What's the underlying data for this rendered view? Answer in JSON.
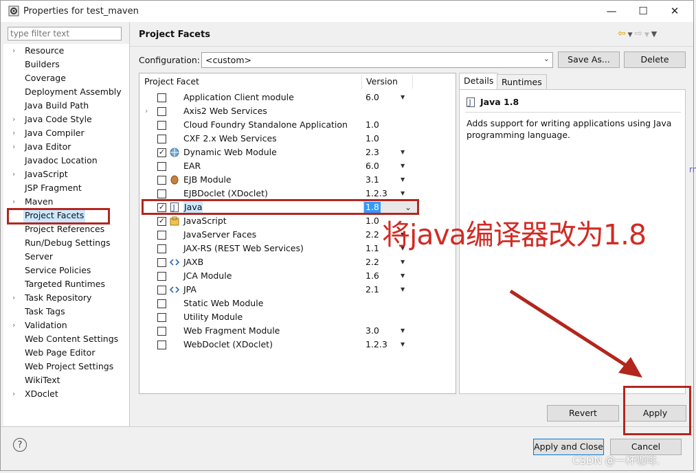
{
  "window": {
    "title": "Properties for test_maven",
    "minimize": "—",
    "maximize": "☐",
    "close": "✕"
  },
  "filter": {
    "placeholder": "type filter text"
  },
  "tree": {
    "items": [
      {
        "label": "Resource",
        "expandable": true
      },
      {
        "label": "Builders",
        "expandable": false
      },
      {
        "label": "Coverage",
        "expandable": false
      },
      {
        "label": "Deployment Assembly",
        "expandable": false
      },
      {
        "label": "Java Build Path",
        "expandable": false
      },
      {
        "label": "Java Code Style",
        "expandable": true
      },
      {
        "label": "Java Compiler",
        "expandable": true
      },
      {
        "label": "Java Editor",
        "expandable": true
      },
      {
        "label": "Javadoc Location",
        "expandable": false
      },
      {
        "label": "JavaScript",
        "expandable": true
      },
      {
        "label": "JSP Fragment",
        "expandable": false
      },
      {
        "label": "Maven",
        "expandable": true
      },
      {
        "label": "Project Facets",
        "expandable": false,
        "selected": true
      },
      {
        "label": "Project References",
        "expandable": false
      },
      {
        "label": "Run/Debug Settings",
        "expandable": false
      },
      {
        "label": "Server",
        "expandable": false
      },
      {
        "label": "Service Policies",
        "expandable": false
      },
      {
        "label": "Targeted Runtimes",
        "expandable": false
      },
      {
        "label": "Task Repository",
        "expandable": true
      },
      {
        "label": "Task Tags",
        "expandable": false
      },
      {
        "label": "Validation",
        "expandable": true
      },
      {
        "label": "Web Content Settings",
        "expandable": false
      },
      {
        "label": "Web Page Editor",
        "expandable": false
      },
      {
        "label": "Web Project Settings",
        "expandable": false
      },
      {
        "label": "WikiText",
        "expandable": false
      },
      {
        "label": "XDoclet",
        "expandable": true
      }
    ]
  },
  "page": {
    "title": "Project Facets",
    "configuration_label": "Configuration:",
    "configuration_value": "<custom>",
    "save_as": "Save As...",
    "delete": "Delete"
  },
  "facets": {
    "col_facet": "Project Facet",
    "col_version": "Version",
    "rows": [
      {
        "name": "Application Client module",
        "version": "6.0",
        "checked": false,
        "dropdown": true,
        "expand": false,
        "icon": "blank"
      },
      {
        "name": "Axis2 Web Services",
        "version": "",
        "checked": false,
        "dropdown": false,
        "expand": true,
        "icon": "blank"
      },
      {
        "name": "Cloud Foundry Standalone Application",
        "version": "1.0",
        "checked": false,
        "dropdown": false,
        "expand": false,
        "icon": "blank"
      },
      {
        "name": "CXF 2.x Web Services",
        "version": "1.0",
        "checked": false,
        "dropdown": false,
        "expand": false,
        "icon": "blank"
      },
      {
        "name": "Dynamic Web Module",
        "version": "2.3",
        "checked": true,
        "dropdown": true,
        "expand": false,
        "icon": "globe"
      },
      {
        "name": "EAR",
        "version": "6.0",
        "checked": false,
        "dropdown": true,
        "expand": false,
        "icon": "blank"
      },
      {
        "name": "EJB Module",
        "version": "3.1",
        "checked": false,
        "dropdown": true,
        "expand": false,
        "icon": "bean"
      },
      {
        "name": "EJBDoclet (XDoclet)",
        "version": "1.2.3",
        "checked": false,
        "dropdown": true,
        "expand": false,
        "icon": "blank"
      },
      {
        "name": "Java",
        "version": "1.8",
        "checked": true,
        "dropdown": true,
        "expand": false,
        "icon": "java",
        "selected": true
      },
      {
        "name": "JavaScript",
        "version": "1.0",
        "checked": true,
        "dropdown": false,
        "expand": false,
        "icon": "js"
      },
      {
        "name": "JavaServer Faces",
        "version": "2.2",
        "checked": false,
        "dropdown": true,
        "expand": false,
        "icon": "blank"
      },
      {
        "name": "JAX-RS (REST Web Services)",
        "version": "1.1",
        "checked": false,
        "dropdown": true,
        "expand": false,
        "icon": "blank"
      },
      {
        "name": "JAXB",
        "version": "2.2",
        "checked": false,
        "dropdown": true,
        "expand": false,
        "icon": "xml"
      },
      {
        "name": "JCA Module",
        "version": "1.6",
        "checked": false,
        "dropdown": true,
        "expand": false,
        "icon": "blank"
      },
      {
        "name": "JPA",
        "version": "2.1",
        "checked": false,
        "dropdown": true,
        "expand": false,
        "icon": "xml"
      },
      {
        "name": "Static Web Module",
        "version": "",
        "checked": false,
        "dropdown": false,
        "expand": false,
        "icon": "blank"
      },
      {
        "name": "Utility Module",
        "version": "",
        "checked": false,
        "dropdown": false,
        "expand": false,
        "icon": "blank"
      },
      {
        "name": "Web Fragment Module",
        "version": "3.0",
        "checked": false,
        "dropdown": true,
        "expand": false,
        "icon": "blank"
      },
      {
        "name": "WebDoclet (XDoclet)",
        "version": "1.2.3",
        "checked": false,
        "dropdown": true,
        "expand": false,
        "icon": "blank"
      }
    ]
  },
  "details": {
    "tab_details": "Details",
    "tab_runtimes": "Runtimes",
    "title": "Java 1.8",
    "description": "Adds support for writing applications using Java programming language."
  },
  "buttons": {
    "revert": "Revert",
    "apply": "Apply",
    "apply_close": "Apply and Close",
    "cancel": "Cancel",
    "help": "?"
  },
  "annotation": {
    "text": "将java编译器改为1.8",
    "color": "#d22a24"
  },
  "watermark": "CSDN @一杯咖啡.",
  "stray_text": "rm"
}
